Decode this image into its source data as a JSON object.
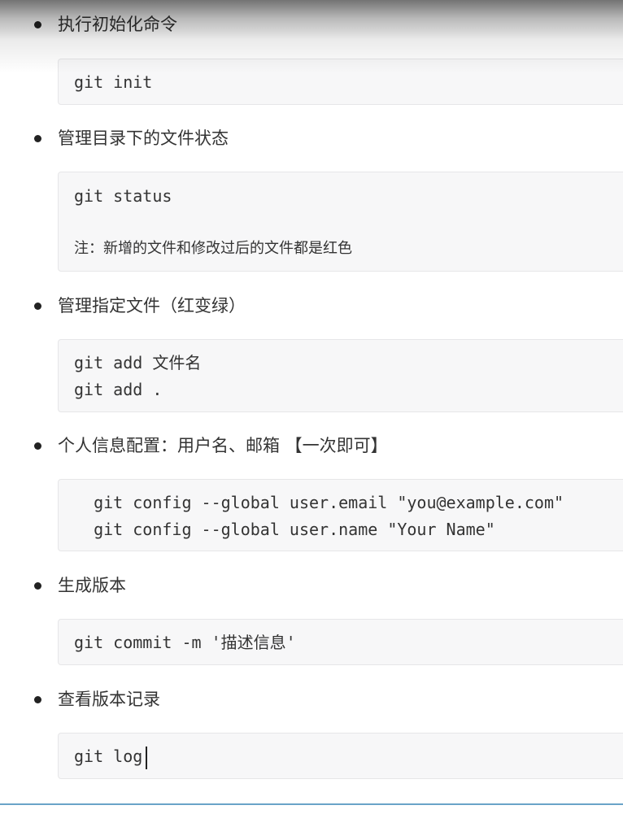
{
  "sections": [
    {
      "heading": "执行初始化命令",
      "code_lines": [
        "git init"
      ]
    },
    {
      "heading": "管理目录下的文件状态",
      "code_lines": [
        "git status"
      ],
      "note": "注：新增的文件和修改过后的文件都是红色"
    },
    {
      "heading": "管理指定文件（红变绿）",
      "code_lines": [
        "git add 文件名",
        "git add ."
      ]
    },
    {
      "heading": "个人信息配置：用户名、邮箱 【一次即可】",
      "code_lines": [
        "  git config --global user.email \"you@example.com\"",
        "  git config --global user.name \"Your Name\""
      ]
    },
    {
      "heading": "生成版本",
      "code_lines": [
        "git commit -m '描述信息'"
      ]
    },
    {
      "heading": "查看版本记录",
      "code_lines": [
        "git log"
      ]
    }
  ]
}
